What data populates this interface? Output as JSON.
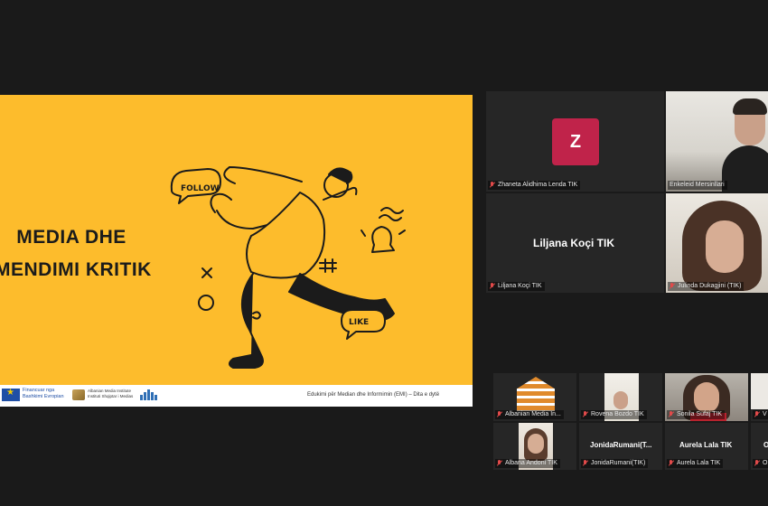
{
  "slide": {
    "title_line1": "MEDIA DHE",
    "title_line2": "MENDIMI KRITIK",
    "stickers": {
      "follow": "FOLLOW",
      "like": "LIKE"
    },
    "footer": {
      "funding_line1": "Financuar nga",
      "funding_line2": "Bashkimi Evropian",
      "ami_line1": "Albanian Media Institute",
      "ami_line2": "Instituti Shqiptar i Medias",
      "caption": "Edukimi për Median dhe Informimin (EMI) – Dita e dytë"
    }
  },
  "participants": [
    {
      "name": "Zhaneta Alidhima Lenda TIK",
      "initial": "Z",
      "muted": true
    },
    {
      "name": "Enkeleid Mersinllari",
      "muted": false,
      "active": true
    },
    {
      "name": "Liljana Koçi TIK",
      "display": "Liljana Koçi TIK",
      "muted": true
    },
    {
      "name": "Julinda Dukagjini (TIK)",
      "muted": true
    },
    {
      "name": "Albanian Media In...",
      "muted": true
    },
    {
      "name": "Rovena Bozdo TIK",
      "muted": true
    },
    {
      "name": "Sonila Sufaj TIK",
      "muted": true
    },
    {
      "name": "V",
      "muted": true
    },
    {
      "name": "Albana Andoni TIK",
      "muted": true
    },
    {
      "name": "JonidaRumani(TIK)",
      "display": "JonidaRumani(T...",
      "muted": true
    },
    {
      "name": "Aurela Lala TIK",
      "display": "Aurela Lala TIK",
      "muted": true
    },
    {
      "name": "O",
      "display": "O",
      "muted": true
    }
  ],
  "colors": {
    "slide_bg": "#fdbc2c",
    "avatar_z": "#c0234a",
    "active_outline": "#7ee0a6"
  }
}
